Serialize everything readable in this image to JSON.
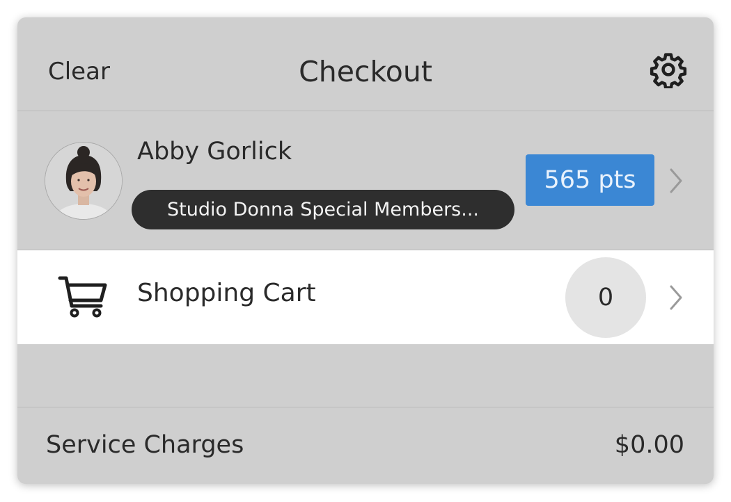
{
  "header": {
    "clear_label": "Clear",
    "title": "Checkout",
    "settings_icon": "gear-icon"
  },
  "customer": {
    "name": "Abby Gorlick",
    "membership": "Studio Donna Special Members...",
    "points": "565 pts",
    "avatar_icon": "avatar-photo"
  },
  "cart": {
    "label": "Shopping Cart",
    "count": "0",
    "icon": "shopping-cart-icon"
  },
  "service": {
    "label": "Service Charges",
    "value": "$0.00"
  },
  "colors": {
    "background": "#cfcfcf",
    "points_badge": "#3b87d4",
    "membership_pill": "#2e2e2e",
    "cart_row": "#ffffff"
  }
}
